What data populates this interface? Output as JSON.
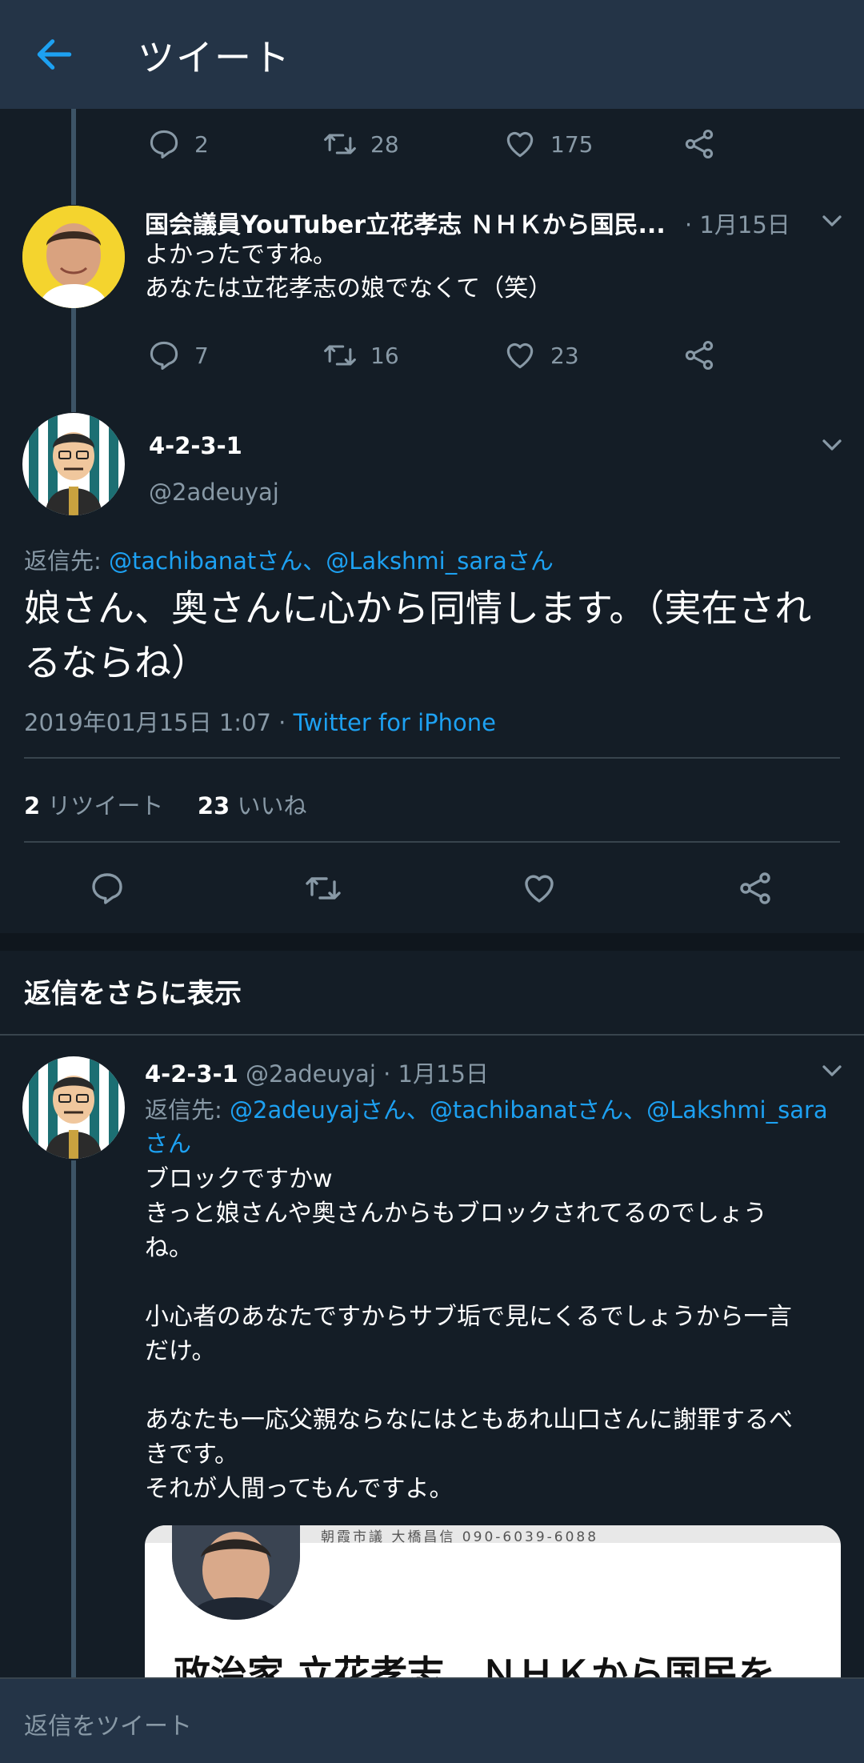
{
  "header": {
    "title": "ツイート"
  },
  "top_actions": {
    "reply": "2",
    "retweet": "28",
    "like": "175"
  },
  "tweet1": {
    "name": "国会議員YouTuber立花孝志 ＮＨＫから国民...",
    "date": "· 1月15日",
    "lines": [
      "よかったですね。",
      "あなたは立花孝志の娘でなくて（笑）"
    ],
    "actions": {
      "reply": "7",
      "retweet": "16",
      "like": "23"
    }
  },
  "main": {
    "name": "4-2-3-1",
    "handle": "@2adeuyaj",
    "reply_to_prefix": "返信先: ",
    "reply_to_users": "@tachibanatさん、@Lakshmi_saraさん",
    "text_line1": "娘さん、奥さんに心から同情します。（実在され",
    "text_line2": "るならね）",
    "timestamp": "2019年01月15日 1:07 · ",
    "source": "Twitter for iPhone",
    "retweet_count": "2",
    "retweet_label": "リツイート",
    "like_count": "23",
    "like_label": "いいね"
  },
  "more_replies": {
    "label": "返信をさらに表示"
  },
  "reply": {
    "name": "4-2-3-1",
    "handle_date": "@2adeuyaj · 1月15日",
    "reply_to_prefix": "返信先: ",
    "reply_to_line1": "@2adeuyajさん、@tachibanatさん、@Lakshmi_sara",
    "reply_to_line2": "さん",
    "lines": [
      "ブロックですかw",
      "きっと娘さんや奥さんからもブロックされてるのでしょう",
      "ね。",
      "",
      "小心者のあなたですからサブ垢で見にくるでしょうから一言",
      "だけ。",
      "",
      "あなたも一応父親ならなにはともあれ山口さんに謝罪するべ",
      "きです。",
      "それが人間ってもんですよ。"
    ]
  },
  "card": {
    "banner_text": "朝霞市議  大橋昌信  090-6039-6088",
    "title": "政治家 立花孝志　ＮＨＫから国民を"
  },
  "footer": {
    "placeholder": "返信をツイート"
  },
  "colors": {
    "accent": "#1da1f2",
    "background": "#141d26",
    "header": "#243447",
    "secondary_text": "#8899a6"
  }
}
